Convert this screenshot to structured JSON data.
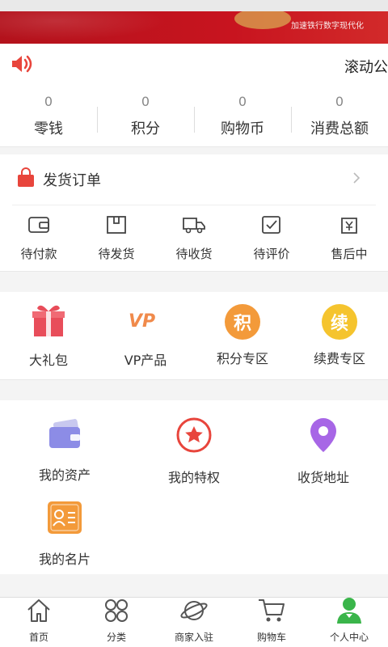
{
  "banner": {
    "slogan": "加速铁行数字现代化"
  },
  "notice": {
    "text": "滚动公"
  },
  "stats": [
    {
      "value": "0",
      "label": "零钱"
    },
    {
      "value": "0",
      "label": "积分"
    },
    {
      "value": "0",
      "label": "购物币"
    },
    {
      "value": "0",
      "label": "消费总额"
    }
  ],
  "orders": {
    "title": "发货订单",
    "items": [
      {
        "label": "待付款",
        "icon": "wallet-icon"
      },
      {
        "label": "待发货",
        "icon": "package-icon"
      },
      {
        "label": "待收货",
        "icon": "truck-icon"
      },
      {
        "label": "待评价",
        "icon": "review-check-icon"
      },
      {
        "label": "售后中",
        "icon": "yen-refund-icon"
      }
    ]
  },
  "shop": {
    "items": [
      {
        "label": "大礼包",
        "icon": "gift-icon"
      },
      {
        "label": "VP产品",
        "icon": "vp-logo-icon",
        "logo_text": "VP"
      },
      {
        "label": "积分专区",
        "icon": "points-badge-icon",
        "badge": "积",
        "color": "#f39a3a"
      },
      {
        "label": "续费专区",
        "icon": "renew-badge-icon",
        "badge": "续",
        "color": "#f5c42e"
      }
    ]
  },
  "services": {
    "items": [
      {
        "label": "我的资产",
        "icon": "wallet-card-icon"
      },
      {
        "label": "我的特权",
        "icon": "star-badge-icon"
      },
      {
        "label": "收货地址",
        "icon": "location-pin-icon"
      },
      {
        "label": "我的名片",
        "icon": "business-card-icon"
      }
    ]
  },
  "tabbar": {
    "items": [
      {
        "label": "首页",
        "icon": "home-icon"
      },
      {
        "label": "分类",
        "icon": "category-icon"
      },
      {
        "label": "商家入驻",
        "icon": "planet-icon"
      },
      {
        "label": "购物车",
        "icon": "cart-icon"
      },
      {
        "label": "个人中心",
        "icon": "user-icon"
      }
    ]
  },
  "colors": {
    "brand_red": "#e8453c",
    "banner_red": "#c8141f",
    "user_green": "#3ab54a"
  }
}
